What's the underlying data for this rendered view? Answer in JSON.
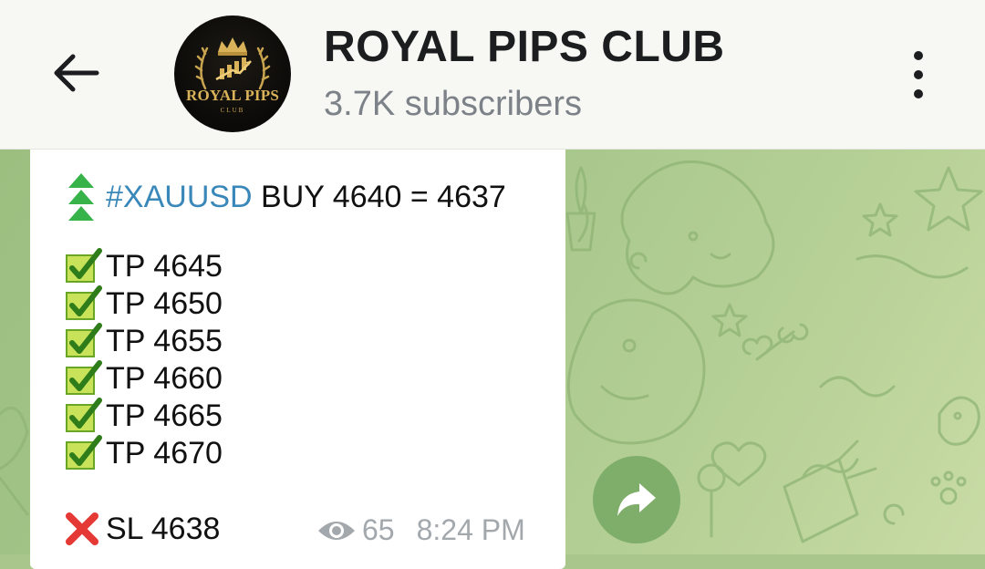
{
  "header": {
    "back_icon": "arrow-left-icon",
    "channel_name": "ROYAL PIPS CLUB",
    "subscribers": "3.7K subscribers",
    "avatar": {
      "logo_text": "ROYAL PIPS",
      "logo_sub": "CLUB"
    },
    "menu_icon": "more-vertical-icon"
  },
  "message": {
    "signal_icon": "up-triangles-icon",
    "hashtag": "#XAUUSD",
    "signal_text": " BUY 4640 = 4637",
    "take_profits": [
      {
        "icon": "check-box-icon",
        "label": "TP 4645"
      },
      {
        "icon": "check-box-icon",
        "label": "TP 4650"
      },
      {
        "icon": "check-box-icon",
        "label": "TP 4655"
      },
      {
        "icon": "check-box-icon",
        "label": "TP 4660"
      },
      {
        "icon": "check-box-icon",
        "label": "TP 4665"
      },
      {
        "icon": "check-box-icon",
        "label": "TP 4670"
      }
    ],
    "stop_loss": {
      "icon": "cross-mark-icon",
      "label": "SL 4638"
    },
    "views": "65",
    "time": "8:24 PM"
  },
  "forward_button": {
    "icon": "share-arrow-icon"
  },
  "colors": {
    "header_bg": "#f7f8f4",
    "chat_bg": "#a8c78d",
    "hashtag": "#3a87b9",
    "meta": "#a3a8ad",
    "forward_btn": "#7fae6a"
  }
}
